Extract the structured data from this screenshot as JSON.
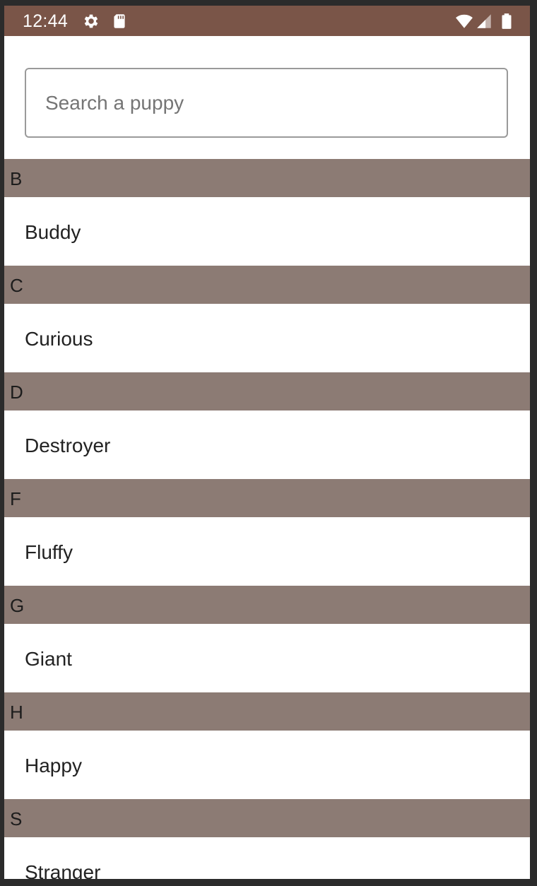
{
  "status_bar": {
    "time": "12:44",
    "icons": [
      "settings-gear-icon",
      "sd-card-icon",
      "wifi-icon",
      "cell-signal-icon",
      "battery-icon"
    ],
    "color": "#7a5548"
  },
  "search": {
    "placeholder": "Search a puppy",
    "value": ""
  },
  "sections": [
    {
      "letter": "B",
      "items": [
        "Buddy"
      ]
    },
    {
      "letter": "C",
      "items": [
        "Curious"
      ]
    },
    {
      "letter": "D",
      "items": [
        "Destroyer"
      ]
    },
    {
      "letter": "F",
      "items": [
        "Fluffy"
      ]
    },
    {
      "letter": "G",
      "items": [
        "Giant"
      ]
    },
    {
      "letter": "H",
      "items": [
        "Happy"
      ]
    },
    {
      "letter": "S",
      "items": [
        "Stranger"
      ]
    }
  ],
  "colors": {
    "section_header_bg": "#8c7b74",
    "item_bg": "#ffffff",
    "frame_bg": "#2b2b2b"
  }
}
